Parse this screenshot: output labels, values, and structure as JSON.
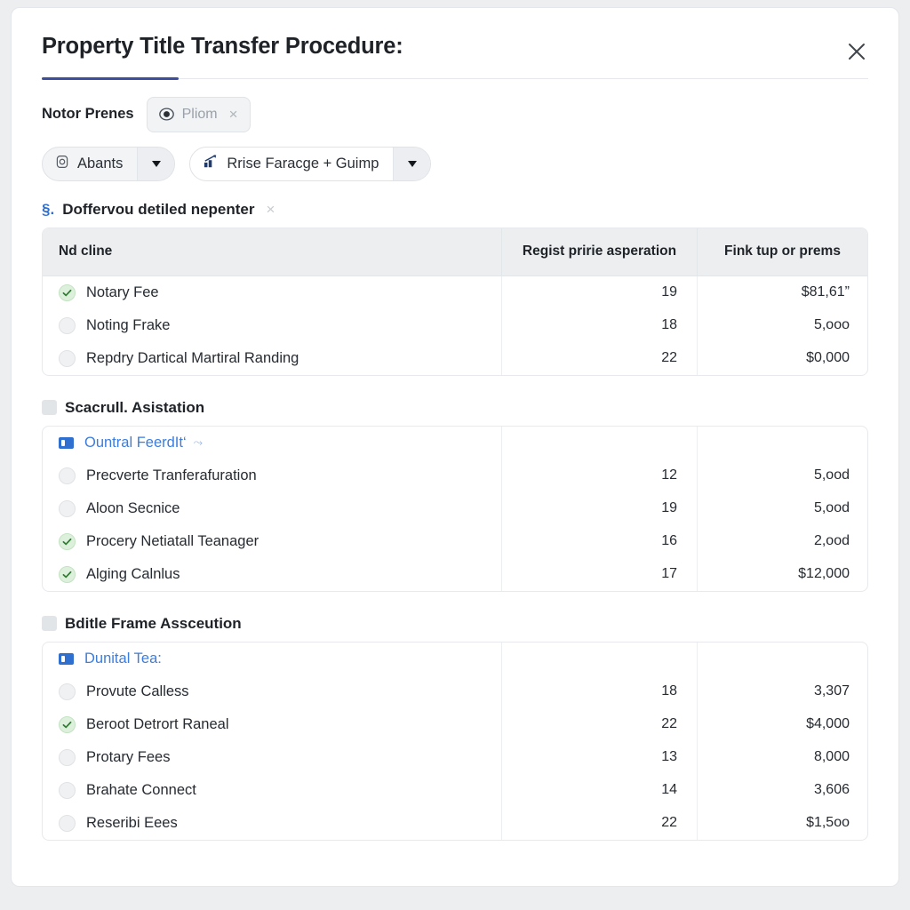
{
  "window": {
    "title": "Property Title Transfer Procedure:",
    "close_label": "close-window"
  },
  "filter": {
    "label": "Notor Prenes",
    "chip": {
      "label": "Pliom",
      "icon": "eye-icon",
      "remove": "×"
    },
    "pills": [
      {
        "label": "Abants",
        "icon": "fingerprint-icon",
        "style": "gray"
      },
      {
        "label": "Rrise Faracge + Guimp",
        "icon": "chart-icon",
        "style": "white"
      }
    ]
  },
  "columns": {
    "name": "Nd cline",
    "count": "Regist pririe asperation",
    "amount": "Fink tup or prems"
  },
  "sections": [
    {
      "marker": "§.",
      "title": "Doffervou detiled nepenter",
      "dismiss": "×",
      "link_row": null,
      "rows": [
        {
          "checked": true,
          "label": "Notary Fee",
          "count": "19",
          "amount": "$81,61”"
        },
        {
          "checked": false,
          "label": "Noting Frake",
          "count": "18",
          "amount": "5,ooo"
        },
        {
          "checked": false,
          "label": "Repdry Dartical Martiral Randing",
          "count": "22",
          "amount": "$0,000"
        }
      ]
    },
    {
      "marker": "",
      "title": "Scacrull. Asistation",
      "dismiss": "",
      "link_row": {
        "label": "Ountral FeerdIt‘",
        "suffix": "⤳"
      },
      "rows": [
        {
          "checked": false,
          "label": "Precverte Tranferafuration",
          "count": "12",
          "amount": "5,ood"
        },
        {
          "checked": false,
          "label": "Aloon Secnice",
          "count": "19",
          "amount": "5,ood"
        },
        {
          "checked": true,
          "label": "Procery Netiatall Teanager",
          "count": "16",
          "amount": "2,ood"
        },
        {
          "checked": true,
          "label": "Alging Calnlus",
          "count": "17",
          "amount": "$12,000"
        }
      ]
    },
    {
      "marker": "",
      "title": "Bditle Frame Assceution",
      "dismiss": "",
      "link_row": {
        "label": "Dunital Tea:",
        "suffix": ""
      },
      "rows": [
        {
          "checked": false,
          "label": "Provute Calless",
          "count": "18",
          "amount": "3,307"
        },
        {
          "checked": true,
          "label": "Beroot Detrort Raneal",
          "count": "22",
          "amount": "$4,000"
        },
        {
          "checked": false,
          "label": "Protary Fees",
          "count": "13",
          "amount": "8,000"
        },
        {
          "checked": false,
          "label": "Brahate Connect",
          "count": "14",
          "amount": "3,606"
        },
        {
          "checked": false,
          "label": "Reseribi Eees",
          "count": "22",
          "amount": "$1,5oo"
        }
      ]
    }
  ],
  "colors": {
    "accent": "#3b4ea0",
    "link": "#3b7ddd",
    "check": "#2f7d32",
    "header_bg": "#eceef0"
  }
}
